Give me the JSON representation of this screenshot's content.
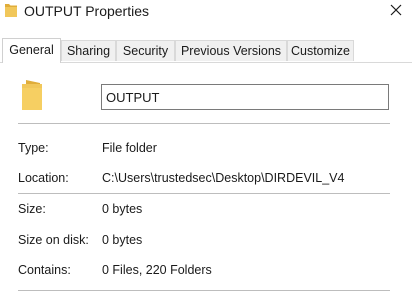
{
  "window": {
    "title": "OUTPUT Properties",
    "close_glyph": "✕",
    "title_icon": "folder-icon",
    "close_icon": "close-icon"
  },
  "tabs": [
    {
      "label": "General",
      "active": true
    },
    {
      "label": "Sharing",
      "active": false
    },
    {
      "label": "Security",
      "active": false
    },
    {
      "label": "Previous Versions",
      "active": false
    },
    {
      "label": "Customize",
      "active": false
    }
  ],
  "general": {
    "folder_icon": "folder-icon",
    "name_value": "OUTPUT",
    "properties": [
      {
        "label": "Type:",
        "value": "File folder"
      },
      {
        "label": "Location:",
        "value": "C:\\Users\\trustedsec\\Desktop\\DIRDEVIL_V4"
      },
      {
        "label": "Size:",
        "value": "0 bytes"
      },
      {
        "label": "Size on disk:",
        "value": "0 bytes"
      },
      {
        "label": "Contains:",
        "value": "0 Files, 220 Folders"
      }
    ]
  },
  "colors": {
    "folder": "#f1c75a",
    "folder_dark": "#e0ad3a",
    "tab_inactive_bg": "#f0f0f0",
    "border": "#d9d9d9"
  }
}
